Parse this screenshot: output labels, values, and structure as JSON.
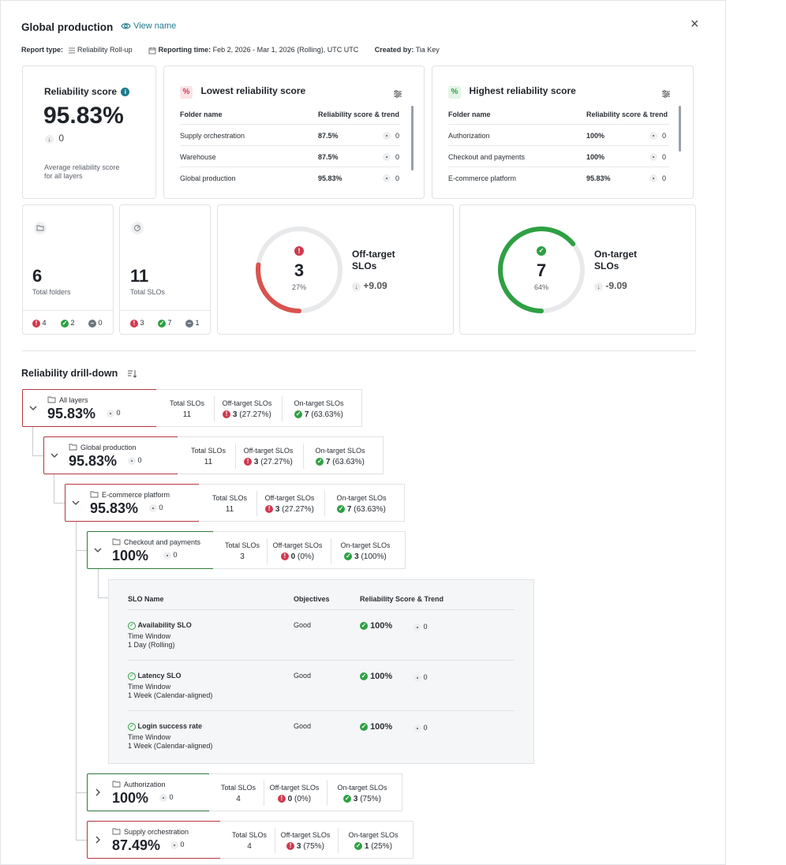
{
  "header": {
    "title": "Global production",
    "view_name": "View name",
    "close": "×"
  },
  "meta": {
    "report_type_label": "Report type:",
    "report_type_value": "Reliability Roll-up",
    "reporting_time_label": "Reporting time:",
    "reporting_time_value": "Feb 2, 2026 - Mar 1, 2026 (Rolling), UTC UTC",
    "created_by_label": "Created by:",
    "created_by_value": "Tia Key"
  },
  "score_card": {
    "title": "Reliability score",
    "value": "95.83%",
    "trend": "0",
    "caption_line1": "Average reliability score",
    "caption_line2": "for all layers"
  },
  "lowest": {
    "title": "Lowest reliability score",
    "col1": "Folder name",
    "col2": "Reliability score & trend",
    "rows": [
      {
        "name": "Supply orchestration",
        "score": "87.5%",
        "trend": "0"
      },
      {
        "name": "Warehouse",
        "score": "87.5%",
        "trend": "0"
      },
      {
        "name": "Global production",
        "score": "95.83%",
        "trend": "0"
      }
    ]
  },
  "highest": {
    "title": "Highest reliability score",
    "col1": "Folder name",
    "col2": "Reliability score & trend",
    "rows": [
      {
        "name": "Authorization",
        "score": "100%",
        "trend": "0"
      },
      {
        "name": "Checkout and payments",
        "score": "100%",
        "trend": "0"
      },
      {
        "name": "E-commerce platform",
        "score": "95.83%",
        "trend": "0"
      }
    ]
  },
  "folders_card": {
    "value": "6",
    "label": "Total folders",
    "red": "4",
    "green": "2",
    "grey": "0"
  },
  "slos_card": {
    "value": "11",
    "label": "Total SLOs",
    "red": "3",
    "green": "7",
    "grey": "1"
  },
  "off_target": {
    "value": "3",
    "pct": "27%",
    "label1": "Off-target",
    "label2": "SLOs",
    "trend": "+9.09",
    "fraction": 0.27
  },
  "on_target": {
    "value": "7",
    "pct": "64%",
    "label1": "On-target",
    "label2": "SLOs",
    "trend": "-9.09",
    "fraction": 0.64
  },
  "drill": {
    "title": "Reliability drill-down",
    "lbl_total": "Total SLOs",
    "lbl_off": "Off-target SLOs",
    "lbl_on": "On-target SLOs",
    "rows": [
      {
        "name": "All layers",
        "score": "95.83%",
        "trend": "0",
        "total": "11",
        "off": "3",
        "off_pct": "(27.27%)",
        "on": "7",
        "on_pct": "(63.63%)"
      },
      {
        "name": "Global production",
        "score": "95.83%",
        "trend": "0",
        "total": "11",
        "off": "3",
        "off_pct": "(27.27%)",
        "on": "7",
        "on_pct": "(63.63%)"
      },
      {
        "name": "E-commerce platform",
        "score": "95.83%",
        "trend": "0",
        "total": "11",
        "off": "3",
        "off_pct": "(27.27%)",
        "on": "7",
        "on_pct": "(63.63%)"
      },
      {
        "name": "Checkout and payments",
        "score": "100%",
        "trend": "0",
        "total": "3",
        "off": "0",
        "off_pct": "(0%)",
        "on": "3",
        "on_pct": "(100%)"
      },
      {
        "name": "Authorization",
        "score": "100%",
        "trend": "0",
        "total": "4",
        "off": "0",
        "off_pct": "(0%)",
        "on": "3",
        "on_pct": "(75%)"
      },
      {
        "name": "Supply orchestration",
        "score": "87.49%",
        "trend": "0",
        "total": "4",
        "off": "3",
        "off_pct": "(75%)",
        "on": "1",
        "on_pct": "(25%)"
      }
    ]
  },
  "slo_table": {
    "col_name": "SLO Name",
    "col_obj": "Objectives",
    "col_score": "Reliability Score & Trend",
    "time_window_label": "Time Window",
    "rows": [
      {
        "name": "Availability SLO",
        "window": "1 Day (Rolling)",
        "objective": "Good",
        "score": "100%",
        "trend": "0"
      },
      {
        "name": "Latency SLO",
        "window": "1 Week (Calendar-aligned)",
        "objective": "Good",
        "score": "100%",
        "trend": "0"
      },
      {
        "name": "Login success rate",
        "window": "1 Week (Calendar-aligned)",
        "objective": "Good",
        "score": "100%",
        "trend": "0"
      }
    ]
  },
  "colors": {
    "red": "#d0394f",
    "green": "#2ea043",
    "teal": "#1f7a8c",
    "ring_bg": "#e8e9eb"
  }
}
